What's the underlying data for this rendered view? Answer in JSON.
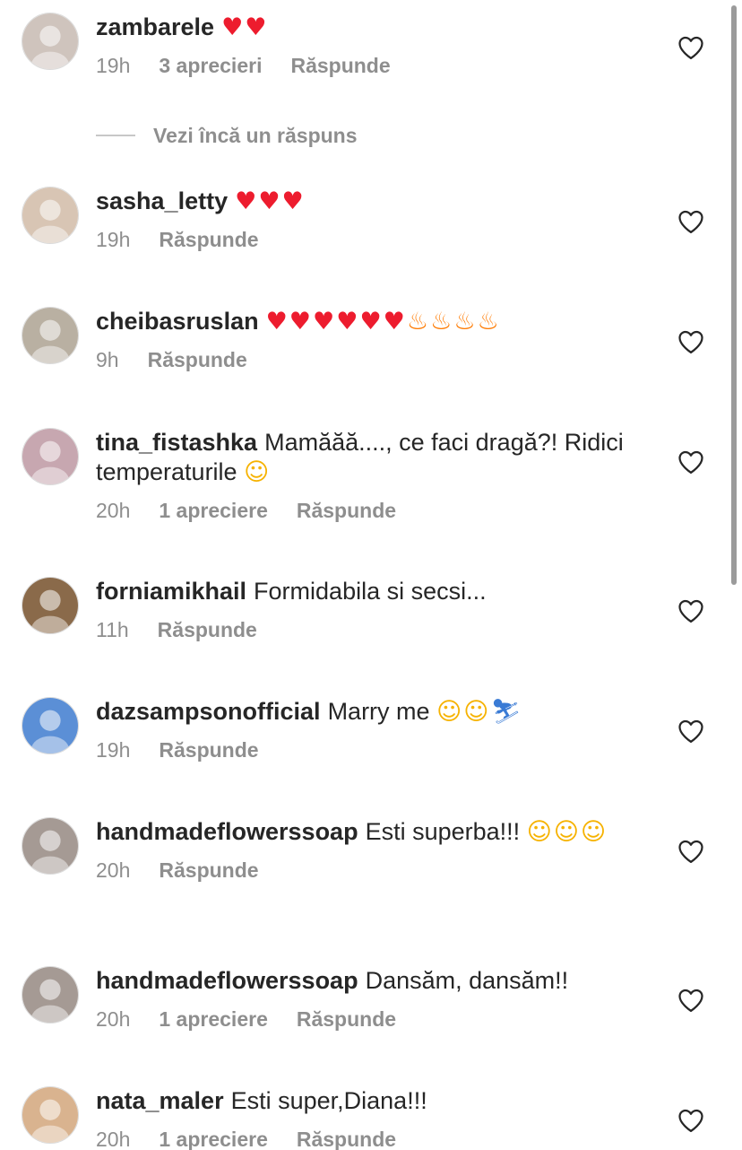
{
  "view_more_replies": "Vezi încă un răspuns",
  "comments": [
    {
      "username": "zambarele",
      "text": "",
      "emojis": "❤️❤️",
      "time": "19h",
      "likes": "3 aprecieri",
      "reply": "Răspunde",
      "avatar_bg": "#cfc4bd"
    },
    {
      "username": "sasha_letty",
      "text": "",
      "emojis": "❤️❤️❤️",
      "time": "19h",
      "likes": "",
      "reply": "Răspunde",
      "avatar_bg": "#d8c5b4"
    },
    {
      "username": "cheibasruslan",
      "text": "",
      "emojis": "❤️❤️❤️❤️❤️❤️🔥🔥🔥🔥",
      "time": "9h",
      "likes": "",
      "reply": "Răspunde",
      "avatar_bg": "#b9b0a2"
    },
    {
      "username": "tina_fistashka",
      "text": "Mamăăă...., ce faci dragă?! Ridici temperaturile",
      "emojis": "🤣",
      "time": "20h",
      "likes": "1 apreciere",
      "reply": "Răspunde",
      "avatar_bg": "#c7a7b0"
    },
    {
      "username": "forniamikhail",
      "text": "Formidabila si secsi...",
      "emojis": "",
      "time": "11h",
      "likes": "",
      "reply": "Răspunde",
      "avatar_bg": "#8a6a4a"
    },
    {
      "username": "dazsampsonofficial",
      "text": "Marry me",
      "emojis": "😀😀🏂",
      "time": "19h",
      "likes": "",
      "reply": "Răspunde",
      "avatar_bg": "#5b8fd6"
    },
    {
      "username": "handmadeflowerssoap",
      "text": "Esti superba!!!",
      "emojis": "😍😍😍",
      "time": "20h",
      "likes": "",
      "reply": "Răspunde",
      "avatar_bg": "#a59a94"
    },
    {
      "username": "handmadeflowerssoap",
      "text": "Dansăm, dansăm!!",
      "emojis": "",
      "time": "20h",
      "likes": "1 apreciere",
      "reply": "Răspunde",
      "avatar_bg": "#a59a94"
    },
    {
      "username": "nata_maler",
      "text": "Esti super,Diana!!!",
      "emojis": "",
      "time": "20h",
      "likes": "1 apreciere",
      "reply": "Răspunde",
      "avatar_bg": "#d9b38f"
    }
  ],
  "colors": {
    "text": "#262626",
    "muted": "#8e8e8e",
    "heart_red": "#ed1c2e",
    "divider": "#c7c7c7"
  },
  "icons": {
    "like": "heart-outline-icon"
  }
}
